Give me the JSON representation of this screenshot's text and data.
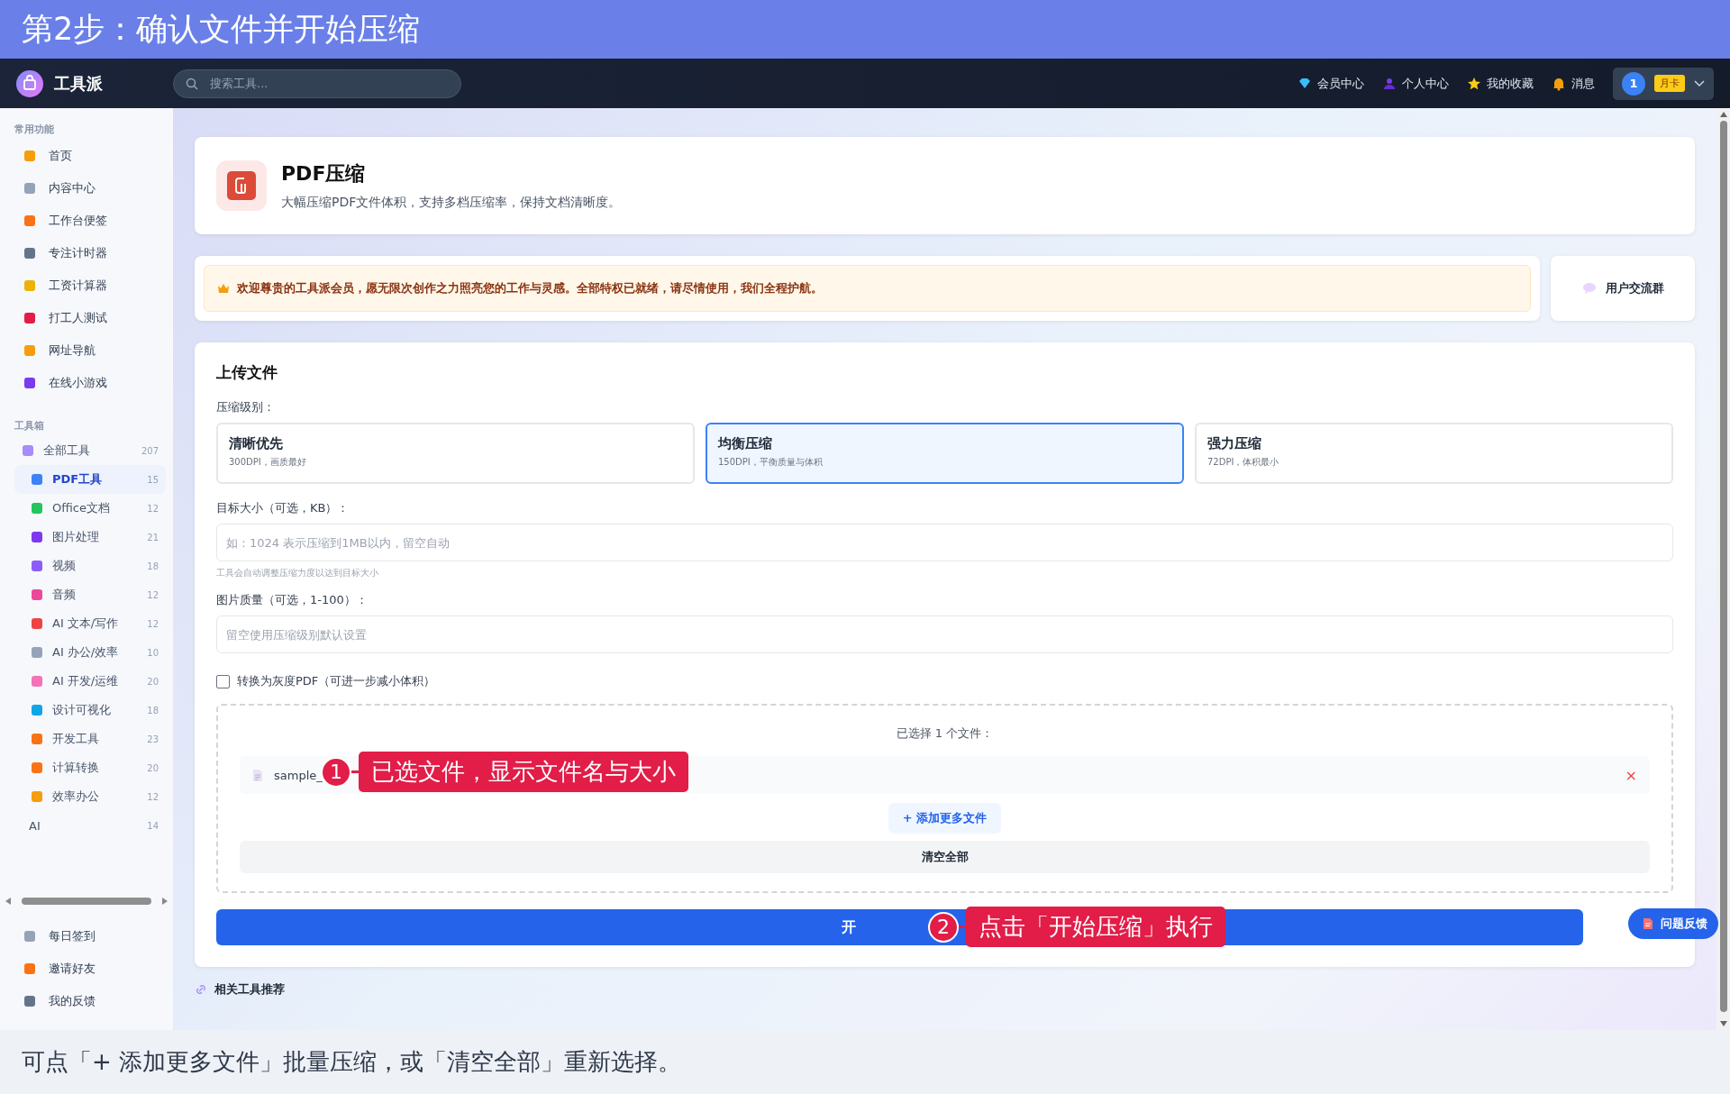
{
  "step_banner": {
    "title": "第2步：确认文件并开始压缩"
  },
  "navbar": {
    "logo_text": "工具派",
    "search": {
      "placeholder": "搜索工具..."
    },
    "links": [
      {
        "label": "会员中心"
      },
      {
        "label": "个人中心"
      },
      {
        "label": "我的收藏"
      },
      {
        "label": "消息"
      }
    ],
    "user": {
      "avatar": "1",
      "badge": "月卡"
    }
  },
  "sidebar": {
    "sections": [
      {
        "title": "常用功能",
        "items": [
          {
            "label": "首页"
          },
          {
            "label": "内容中心"
          },
          {
            "label": "工作台便签"
          },
          {
            "label": "专注计时器"
          },
          {
            "label": "工资计算器"
          },
          {
            "label": "打工人测试"
          },
          {
            "label": "网址导航"
          },
          {
            "label": "在线小游戏"
          }
        ]
      },
      {
        "title": "工具箱",
        "tree": [
          {
            "label": "全部工具",
            "count": "207",
            "selected": false,
            "children": [
              {
                "label": "PDF工具",
                "count": "15",
                "selected": true
              },
              {
                "label": "Office文档",
                "count": "12",
                "selected": false
              },
              {
                "label": "图片处理",
                "count": "21",
                "selected": false
              },
              {
                "label": "视频",
                "count": "18",
                "selected": false
              },
              {
                "label": "音频",
                "count": "12",
                "selected": false
              },
              {
                "label": "AI 文本/写作",
                "count": "12",
                "selected": false
              },
              {
                "label": "AI 办公/效率",
                "count": "10",
                "selected": false
              },
              {
                "label": "AI 开发/运维",
                "count": "20",
                "selected": false
              },
              {
                "label": "设计可视化",
                "count": "18",
                "selected": false
              },
              {
                "label": "开发工具",
                "count": "23",
                "selected": false
              },
              {
                "label": "计算转换",
                "count": "20",
                "selected": false
              },
              {
                "label": "效率办公",
                "count": "12",
                "selected": false
              }
            ]
          },
          {
            "label": "AI",
            "count": "14",
            "selected": false
          }
        ]
      }
    ],
    "footer_items": [
      {
        "label": "每日签到"
      },
      {
        "label": "邀请好友"
      },
      {
        "label": "我的反馈"
      }
    ]
  },
  "tool_header": {
    "title": "PDF压缩",
    "description": "大幅压缩PDF文件体积，支持多档压缩率，保持文档清晰度。"
  },
  "notice": {
    "text": "欢迎尊贵的工具派会员，愿无限次创作之力照亮您的工作与灵感。全部特权已就绪，请尽情使用，我们全程护航。",
    "group_button": "用户交流群"
  },
  "upload": {
    "title": "上传文件",
    "level_label": "压缩级别：",
    "levels": [
      {
        "name": "清晰优先",
        "detail": "300DPI，画质最好",
        "selected": false
      },
      {
        "name": "均衡压缩",
        "detail": "150DPI，平衡质量与体积",
        "selected": true
      },
      {
        "name": "强力压缩",
        "detail": "72DPI，体积最小",
        "selected": false
      }
    ],
    "target_size": {
      "label": "目标大小（可选，KB）：",
      "placeholder": "如：1024 表示压缩到1MB以内，留空自动",
      "hint": "工具会自动调整压缩力度以达到目标大小"
    },
    "quality": {
      "label": "图片质量（可选，1-100）：",
      "placeholder": "留空使用压缩级别默认设置"
    },
    "grayscale": {
      "label": "转换为灰度PDF（可进一步减小体积）",
      "checked": false
    },
    "files": {
      "heading": "已选择 1 个文件：",
      "items": [
        {
          "name": "sample_",
          "remove": "×"
        }
      ],
      "add_more": "+ 添加更多文件",
      "clear_all": "清空全部"
    },
    "start_button": "开"
  },
  "related_title": "相关工具推荐",
  "feedback_button": "问题反馈",
  "annotations": [
    {
      "number": "1",
      "text": "已选文件，显示文件名与大小"
    },
    {
      "number": "2",
      "text": "点击「开始压缩」执行"
    }
  ],
  "caption": "可点「+ 添加更多文件」批量压缩，或「清空全部」重新选择。"
}
